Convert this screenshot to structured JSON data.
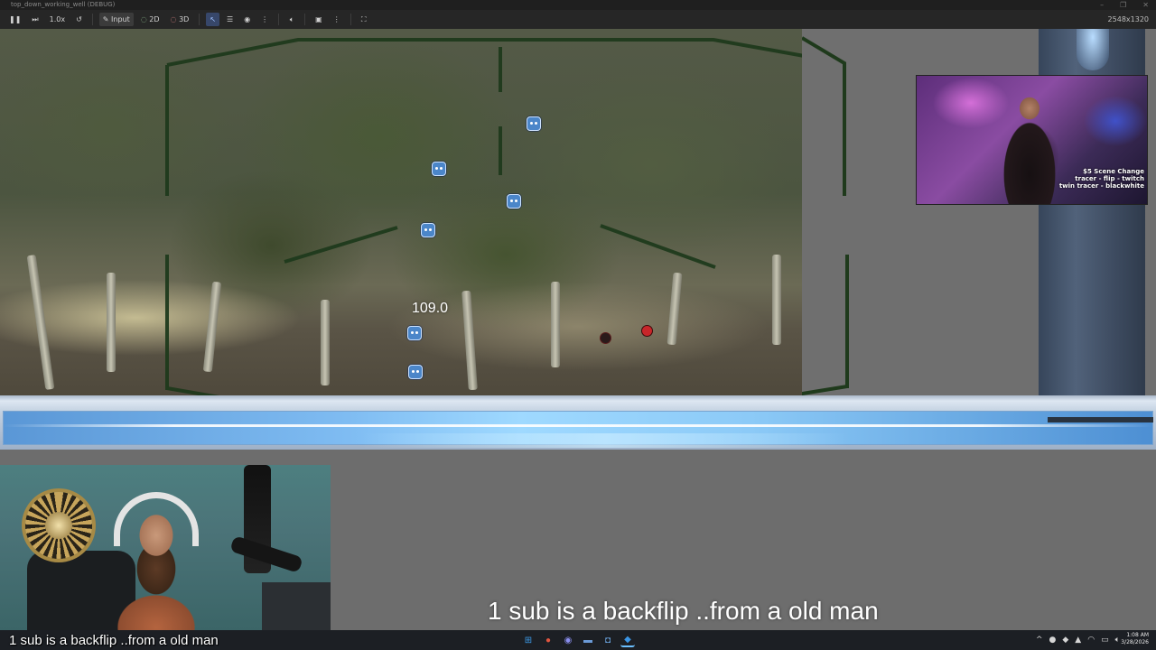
{
  "window": {
    "title": "top_down_working_well (DEBUG)",
    "controls": [
      "–",
      "❐",
      "✕"
    ]
  },
  "toolbar": {
    "zoom": "1.0x",
    "input_label": "Input",
    "mode_2d": "2D",
    "mode_3d": "3D",
    "resolution": "2548x1320"
  },
  "game": {
    "score": "109.0"
  },
  "webcam_top": {
    "overlay_lines": [
      "$5 Scene Change",
      "tracer - flip - twitch",
      "twin tracer - blackwhite"
    ]
  },
  "captions": {
    "overlay_caption": "1 sub is a backflip ..from a old man",
    "cam_caption": "1 sub is a backflip ..from a old man"
  },
  "taskbar": {
    "apps": [
      {
        "icon": "windows-start-icon",
        "glyph": "⊞",
        "color": "#2b88d8"
      },
      {
        "icon": "chrome-icon",
        "glyph": "●",
        "color": "#d64b3c"
      },
      {
        "icon": "discord-icon",
        "glyph": "◉",
        "color": "#6e74d6"
      },
      {
        "icon": "file-explorer-icon",
        "glyph": "▬",
        "color": "#3c6fb0"
      },
      {
        "icon": "godot-icon",
        "glyph": "◘",
        "color": "#4a86c5"
      },
      {
        "icon": "vscode-icon",
        "glyph": "◆",
        "color": "#1f7ad1"
      }
    ],
    "tray_chevron": "^",
    "time": "1:08 AM",
    "date": "3/28/2026"
  },
  "colors": {
    "frame_green": "#1f3a1c",
    "hud_blue": "#7fbcf2",
    "enemy_red": "#c8262a"
  }
}
